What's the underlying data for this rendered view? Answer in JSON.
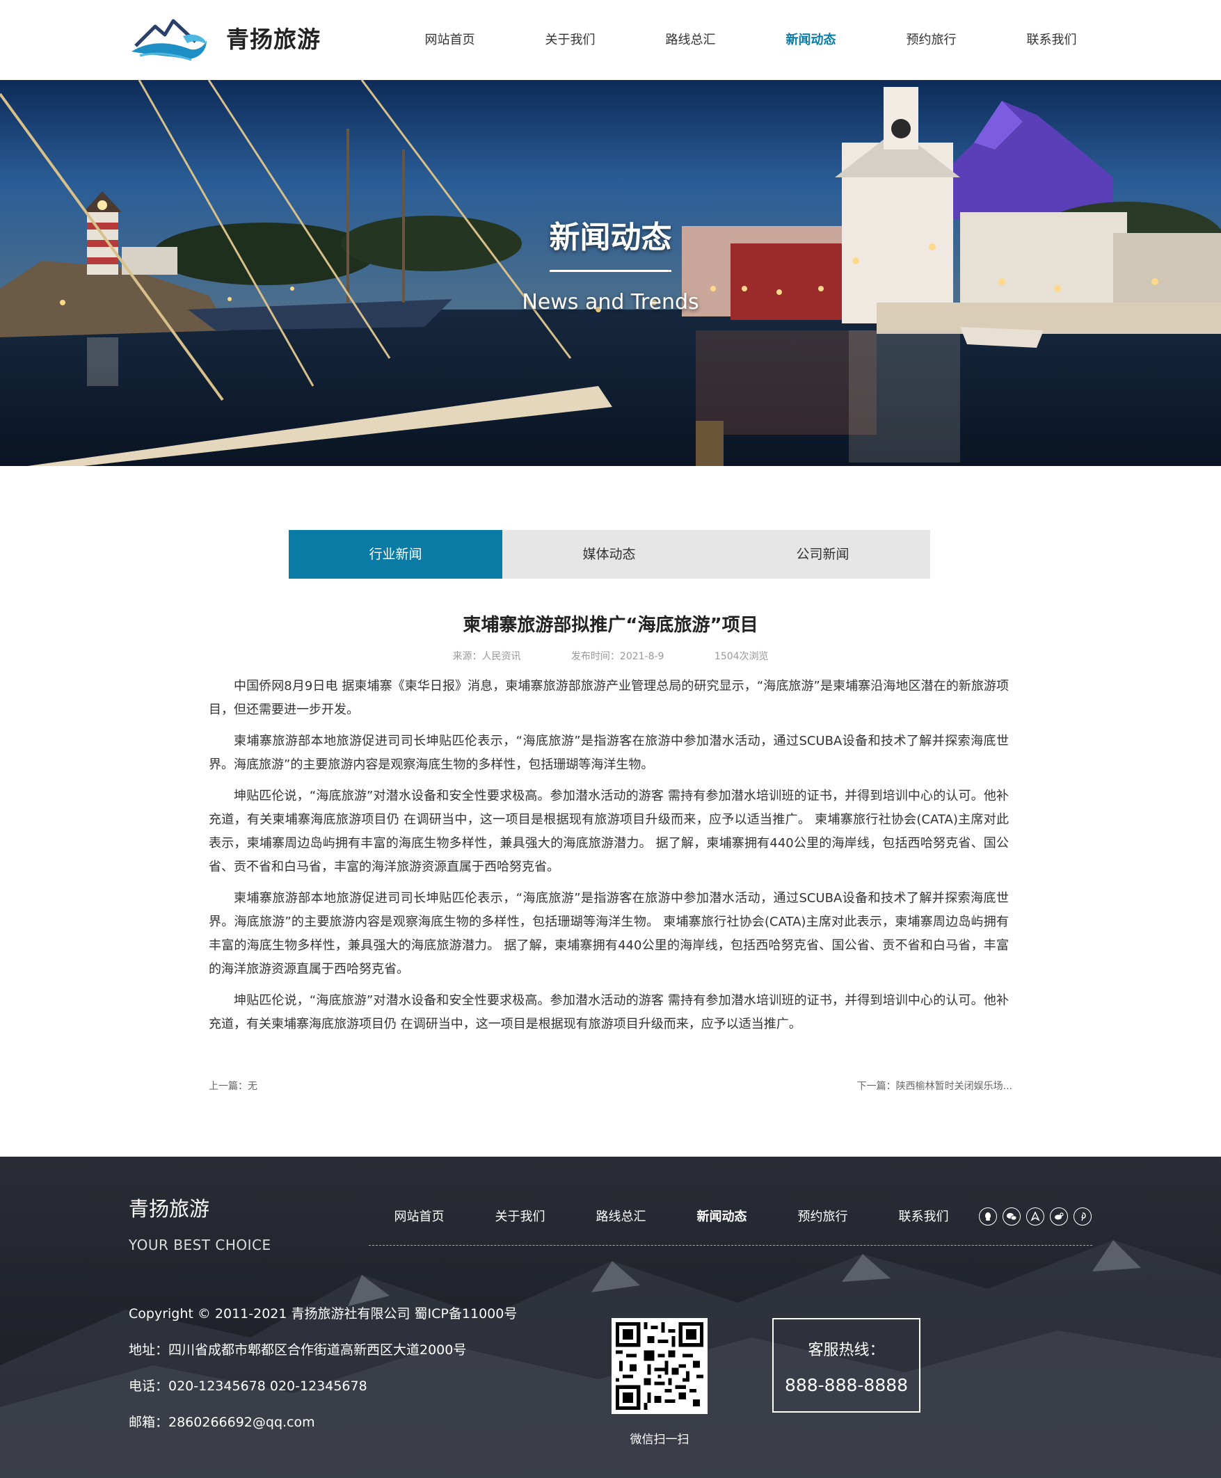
{
  "header": {
    "logo_text": "青扬旅游",
    "nav": [
      "网站首页",
      "关于我们",
      "路线总汇",
      "新闻动态",
      "预约旅行",
      "联系我们"
    ],
    "active_nav": "新闻动态"
  },
  "banner": {
    "title": "新闻动态",
    "subtitle": "News and Trends"
  },
  "tabs": [
    "行业新闻",
    "媒体动态",
    "公司新闻"
  ],
  "active_tab": "行业新闻",
  "article": {
    "title": "柬埔寨旅游部拟推广“海底旅游”项目",
    "source": "来源：人民资讯",
    "date": "发布时间：2021-8-9",
    "views": "1504次浏览",
    "paragraphs": [
      "中国侨网8月9日电 据柬埔寨《柬华日报》消息，柬埔寨旅游部旅游产业管理总局的研究显示，“海底旅游”是柬埔寨沿海地区潜在的新旅游项目，但还需要进一步开发。",
      "柬埔寨旅游部本地旅游促进司司长坤贴匹伦表示，“海底旅游”是指游客在旅游中参加潜水活动，通过SCUBA设备和技术了解并探索海底世界。海底旅游”的主要旅游内容是观察海底生物的多样性，包括珊瑚等海洋生物。",
      "坤贴匹伦说，“海底旅游”对潜水设备和安全性要求极高。参加潜水活动的游客 需持有参加潜水培训班的证书，并得到培训中心的认可。他补充道，有关柬埔寨海底旅游项目仍 在调研当中，这一项目是根据现有旅游项目升级而来，应予以适当推广。 柬埔寨旅行社协会(CATA)主席对此表示，柬埔寨周边岛屿拥有丰富的海底生物多样性，兼具强大的海底旅游潜力。 据了解，柬埔寨拥有440公里的海岸线，包括西哈努克省、国公省、贡不省和白马省，丰富的海洋旅游资源直属于西哈努克省。",
      "柬埔寨旅游部本地旅游促进司司长坤贴匹伦表示，“海底旅游”是指游客在旅游中参加潜水活动，通过SCUBA设备和技术了解并探索海底世界。海底旅游”的主要旅游内容是观察海底生物的多样性，包括珊瑚等海洋生物。 柬埔寨旅行社协会(CATA)主席对此表示，柬埔寨周边岛屿拥有丰富的海底生物多样性，兼具强大的海底旅游潜力。 据了解，柬埔寨拥有440公里的海岸线，包括西哈努克省、国公省、贡不省和白马省，丰富的海洋旅游资源直属于西哈努克省。",
      "坤贴匹伦说，“海底旅游”对潜水设备和安全性要求极高。参加潜水活动的游客 需持有参加潜水培训班的证书，并得到培训中心的认可。他补充道，有关柬埔寨海底旅游项目仍 在调研当中，这一项目是根据现有旅游项目升级而来，应予以适当推广。"
    ],
    "prev": "上一篇：无",
    "next": "下一篇：陕西榆林暂时关闭娱乐场..."
  },
  "footer": {
    "brand": "青扬旅游",
    "slogan": "YOUR BEST CHOICE",
    "nav": [
      "网站首页",
      "关于我们",
      "路线总汇",
      "新闻动态",
      "预约旅行",
      "联系我们"
    ],
    "social_icons": [
      "qq-icon",
      "wechat-icon",
      "alipay-icon",
      "weibo-icon",
      "pinterest-icon"
    ],
    "copyright": "Copyright © 2011-2021 青扬旅游社有限公司 蜀ICP备11000号",
    "address": "地址：四川省成都市郫都区合作街道高新西区大道2000号",
    "phone": "电话：020-12345678 020-12345678",
    "email": "邮箱：2860266692@qq.com",
    "qr_label": "微信扫一扫",
    "hotline_label": "客服热线：",
    "hotline_number": "888-888-8888"
  },
  "colors": {
    "accent": "#0a7ba5",
    "tab_bg": "#e6e6e6",
    "footer_bg": "#22252d"
  }
}
